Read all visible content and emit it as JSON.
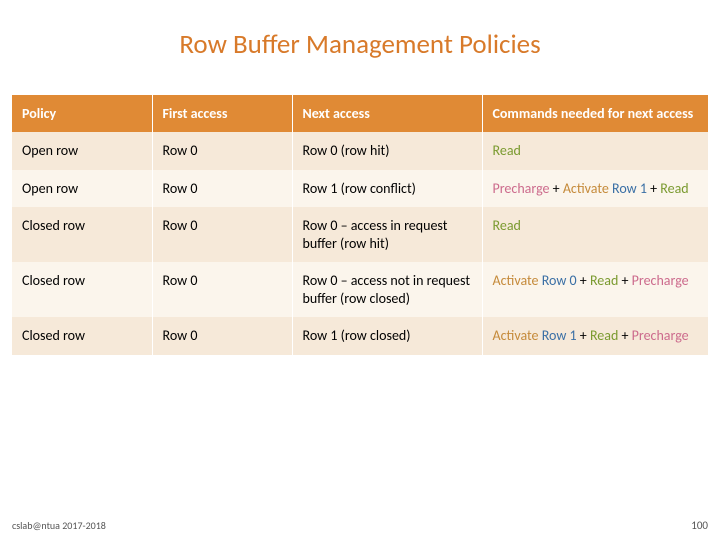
{
  "title": "Row Buffer Management Policies",
  "footer": "cslab@ntua 2017-2018",
  "page": "100",
  "headers": {
    "policy": "Policy",
    "first": "First access",
    "next": "Next access",
    "cmds": "Commands needed for next access"
  },
  "rows": [
    {
      "policy": "Open row",
      "first": "Row 0",
      "next": "Row 0 (row hit)",
      "cmds": [
        {
          "t": "Read",
          "c": "hl-read"
        }
      ]
    },
    {
      "policy": "Open row",
      "first": "Row 0",
      "next": "Row 1 (row conflict)",
      "cmds": [
        {
          "t": "Precharge",
          "c": "hl-precharge"
        },
        {
          "t": " + ",
          "c": ""
        },
        {
          "t": "Activate",
          "c": "hl-activate"
        },
        {
          "t": " ",
          "c": ""
        },
        {
          "t": "Row 1",
          "c": "hl-row"
        },
        {
          "t": " + ",
          "c": ""
        },
        {
          "t": "Read",
          "c": "hl-read"
        }
      ]
    },
    {
      "policy": "Closed row",
      "first": "Row 0",
      "next": "Row 0 – access in request buffer (row hit)",
      "cmds": [
        {
          "t": "Read",
          "c": "hl-read"
        }
      ]
    },
    {
      "policy": "Closed row",
      "first": "Row 0",
      "next": "Row 0 – access not in request buffer (row closed)",
      "cmds": [
        {
          "t": "Activate",
          "c": "hl-activate"
        },
        {
          "t": " ",
          "c": ""
        },
        {
          "t": "Row 0",
          "c": "hl-row"
        },
        {
          "t": " + ",
          "c": ""
        },
        {
          "t": "Read",
          "c": "hl-read"
        },
        {
          "t": " + ",
          "c": ""
        },
        {
          "t": "Precharge",
          "c": "hl-precharge"
        }
      ]
    },
    {
      "policy": "Closed row",
      "first": "Row 0",
      "next": "Row 1 (row closed)",
      "cmds": [
        {
          "t": "Activate",
          "c": "hl-activate"
        },
        {
          "t": " ",
          "c": ""
        },
        {
          "t": "Row 1",
          "c": "hl-row"
        },
        {
          "t": " + ",
          "c": ""
        },
        {
          "t": "Read",
          "c": "hl-read"
        },
        {
          "t": " + ",
          "c": ""
        },
        {
          "t": "Precharge",
          "c": "hl-precharge"
        }
      ]
    }
  ]
}
